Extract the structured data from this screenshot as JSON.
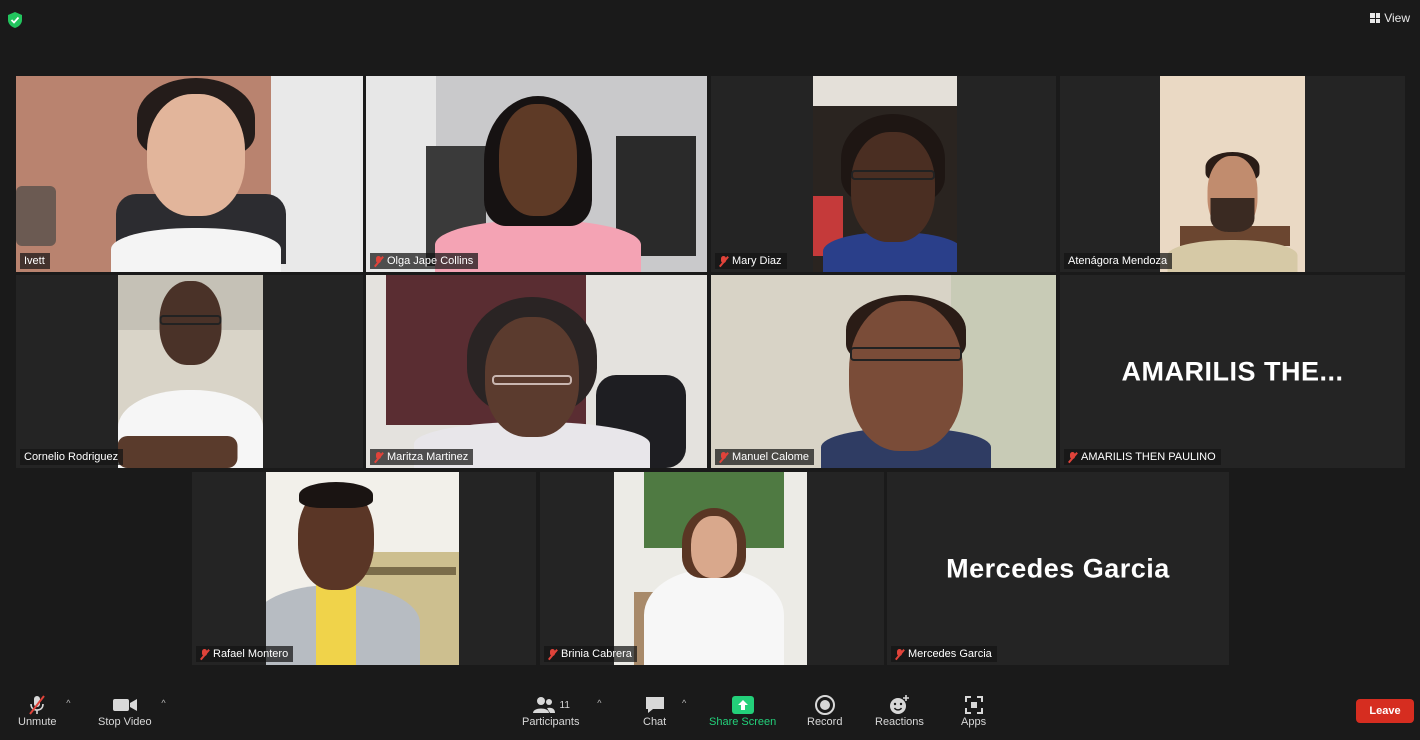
{
  "topbar": {
    "view_label": "View"
  },
  "participants": [
    {
      "name": "Ivett",
      "speaking": true
    },
    {
      "name": "Olga Jape Collins"
    },
    {
      "name": "Mary Diaz"
    },
    {
      "name": "Atenágora Mendoza"
    },
    {
      "name": "Cornelio Rodriguez"
    },
    {
      "name": "Maritza Martinez"
    },
    {
      "name": "Manuel Calome"
    },
    {
      "name": "AMARILIS THEN PAULINO",
      "display_text": "AMARILIS  THE..."
    },
    {
      "name": "Rafael Montero"
    },
    {
      "name": "Brinia Cabrera"
    },
    {
      "name": "Mercedes Garcia",
      "display_text": "Mercedes Garcia"
    }
  ],
  "toolbar": {
    "unmute": "Unmute",
    "stop_video": "Stop Video",
    "participants": "Participants",
    "participants_count": "11",
    "chat": "Chat",
    "share_screen": "Share Screen",
    "record": "Record",
    "reactions": "Reactions",
    "apps": "Apps",
    "leave": "Leave"
  },
  "colors": {
    "background": "#1a1a1a",
    "tile": "#242424",
    "active_speaker_border": "#c9df4e",
    "share_screen": "#23d07a",
    "leave": "#d62d20",
    "muted": "#e0433a"
  },
  "icons": [
    "shield-icon",
    "grid-view-icon",
    "mic-muted-icon",
    "video-camera-icon",
    "participants-icon",
    "chat-icon",
    "share-screen-icon",
    "record-icon",
    "reactions-icon",
    "apps-icon"
  ]
}
